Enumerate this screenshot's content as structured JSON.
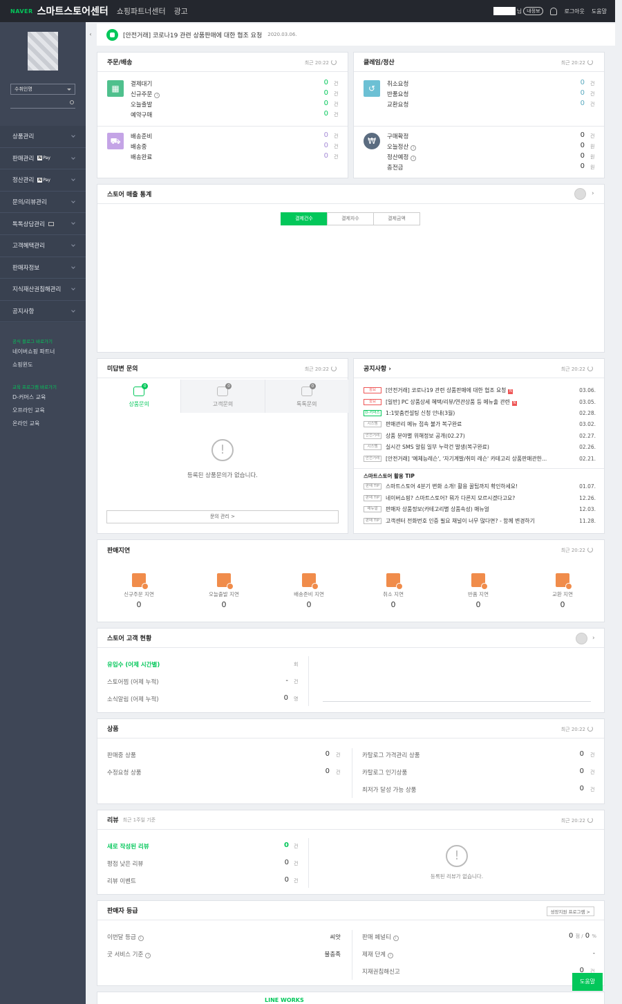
{
  "topbar": {
    "brand": "NAVER",
    "app_title": "스마트스토어센터",
    "nav": [
      "쇼핑파트너센터",
      "광고"
    ],
    "user_suffix": "님",
    "my_info": "내정보",
    "logout": "로그아웃",
    "help": "도움말"
  },
  "sidebar": {
    "select": "수취인명",
    "menu": [
      {
        "label": "상품관리"
      },
      {
        "label": "판매관리",
        "badge": "Pay"
      },
      {
        "label": "정산관리",
        "badge": "Pay"
      },
      {
        "label": "문의/리뷰관리"
      },
      {
        "label": "톡톡상담관리"
      },
      {
        "label": "고객혜택관리"
      },
      {
        "label": "판매자정보"
      },
      {
        "label": "지식재산권침해관리"
      },
      {
        "label": "공지사항"
      }
    ],
    "official_title": "공식 블로그 바로가기",
    "official_links": [
      "네이버쇼핑 파트너",
      "쇼핑윈도"
    ],
    "edu_title": "교육 프로그램 바로가기",
    "edu_links": [
      "D-커머스 교육",
      "오프라인 교육",
      "온라인 교육"
    ]
  },
  "notice_bar": {
    "text": "[안전거래] 코로나19 관련 상품판매에 대한 협조 요청",
    "date": "2020.03.06."
  },
  "refresh_label": "최근 20:22",
  "order": {
    "title": "주문/배송",
    "group1": [
      {
        "label": "결제대기",
        "value": "0",
        "unit": "건"
      },
      {
        "label": "신규주문",
        "value": "0",
        "unit": "건"
      },
      {
        "label": "오늘출발",
        "value": "0",
        "unit": "건"
      },
      {
        "label": "예약구매",
        "value": "0",
        "unit": "건"
      }
    ],
    "group2": [
      {
        "label": "배송준비",
        "value": "0",
        "unit": "건"
      },
      {
        "label": "배송중",
        "value": "0",
        "unit": "건"
      },
      {
        "label": "배송완료",
        "value": "0",
        "unit": "건"
      }
    ]
  },
  "claim": {
    "title": "클레임/정산",
    "group1": [
      {
        "label": "취소요청",
        "value": "0",
        "unit": "건"
      },
      {
        "label": "반품요청",
        "value": "0",
        "unit": "건"
      },
      {
        "label": "교환요청",
        "value": "0",
        "unit": "건"
      }
    ],
    "group2": [
      {
        "label": "구매확정",
        "value": "0",
        "unit": "건"
      },
      {
        "label": "오늘정산",
        "value": "0",
        "unit": "원"
      },
      {
        "label": "정산예정",
        "value": "0",
        "unit": "원"
      },
      {
        "label": "충전금",
        "value": "0",
        "unit": "원"
      }
    ]
  },
  "sales_stats": {
    "title": "스토어 매출 통계",
    "tabs": [
      "결제건수",
      "결제자수",
      "결제금액"
    ]
  },
  "inquiry": {
    "title": "미답변 문의",
    "tabs": [
      {
        "label": "상품문의",
        "count": "0"
      },
      {
        "label": "고객문의",
        "count": "0"
      },
      {
        "label": "톡톡문의",
        "count": "0"
      }
    ],
    "empty": "등록된 상품문의가 없습니다.",
    "manage": "문의 관리 >"
  },
  "notices": {
    "title": "공지사항",
    "items": [
      {
        "tag": "중요",
        "text": "[안전거래] 코로나19 관련 상품판매에 대한 협조 요청",
        "new": "N",
        "date": "03.06."
      },
      {
        "tag": "중요",
        "text": "[일반] PC 상품상세 혜택/리뷰/연관상품 등 메뉴출 관련",
        "new": "N",
        "date": "03.05."
      },
      {
        "tag": "D-커머스",
        "text": "1:1맞춤컨설팅 신청 안내(3월)",
        "date": "02.28."
      },
      {
        "tag": "시스템",
        "text": "판매관리 메뉴 접속 불가 복구완료",
        "date": "03.02."
      },
      {
        "tag": "안전거래",
        "text": "상품 분야별 위해정보 공개(02.27)",
        "date": "02.27."
      },
      {
        "tag": "시스템",
        "text": "실시간 SMS 알림 일부 누락건 발생(복구완료)",
        "date": "02.26."
      },
      {
        "tag": "안전거래",
        "text": "[안전거래] '예체능레슨', '자기계발/취미 레슨' 카테고리 상품판매관한...",
        "date": "02.21."
      }
    ],
    "tip_title": "스마트스토어 활용 TIP",
    "tips": [
      {
        "tag": "판매 TIP",
        "text": "스마트스토어 4분기 변화 소개! 활용 꿀팁까지 확인하세요!",
        "date": "01.07."
      },
      {
        "tag": "판매 TIP",
        "text": "네이버쇼핑? 스마트스토어? 뭐가 다른지 모르시겠다고요?",
        "date": "12.26."
      },
      {
        "tag": "매뉴얼",
        "text": "판매자 상품정보(카테고리별 상품속성) 매뉴얼",
        "date": "12.03."
      },
      {
        "tag": "판매 TIP",
        "text": "고객센터 전화번호 인증 필요 채널이 너무 많다면? - 함께 변경하기",
        "date": "11.28."
      }
    ]
  },
  "delay": {
    "title": "판매지연",
    "items": [
      {
        "label": "신규주문 지연",
        "value": "0"
      },
      {
        "label": "오늘출발 지연",
        "value": "0"
      },
      {
        "label": "배송준비 지연",
        "value": "0"
      },
      {
        "label": "취소 지연",
        "value": "0"
      },
      {
        "label": "반품 지연",
        "value": "0"
      },
      {
        "label": "교환 지연",
        "value": "0"
      }
    ]
  },
  "customer": {
    "title": "스토어 고객 현황",
    "rows": [
      {
        "label": "유입수 (어제 시간별)",
        "value": "",
        "unit": "회"
      },
      {
        "label": "스토어찜 (어제 누적)",
        "value": "-",
        "unit": "건"
      },
      {
        "label": "소식알림 (어제 누적)",
        "value": "0",
        "unit": "명"
      }
    ]
  },
  "product": {
    "title": "상품",
    "left": [
      {
        "label": "판매중 상품",
        "value": "0",
        "unit": "건"
      },
      {
        "label": "수정요청 상품",
        "value": "0",
        "unit": "건"
      }
    ],
    "right": [
      {
        "label": "카탈로그 가격관리 상품",
        "value": "0",
        "unit": "건"
      },
      {
        "label": "카탈로그 인기상품",
        "value": "0",
        "unit": "건"
      },
      {
        "label": "최저가 달성 가능 상품",
        "value": "0",
        "unit": "건"
      }
    ]
  },
  "review": {
    "title": "리뷰",
    "subtitle": "최근 1주일 기준",
    "rows": [
      {
        "label": "새로 작성된 리뷰",
        "value": "0",
        "unit": "건"
      },
      {
        "label": "평점 낮은 리뷰",
        "value": "0",
        "unit": "건"
      },
      {
        "label": "리뷰 이벤트",
        "value": "0",
        "unit": "건"
      }
    ],
    "empty": "등록된 리뷰가 없습니다."
  },
  "grade": {
    "title": "판매자 등급",
    "program": "성장지원 프로그램 >",
    "left": [
      {
        "label": "이번달 등급",
        "value": "씨앗"
      },
      {
        "label": "굿 서비스 기준",
        "value": "불충족"
      }
    ],
    "right": [
      {
        "label": "판매 페널티",
        "value": "0",
        "sep": "점 /",
        "value2": "0",
        "unit": "%"
      },
      {
        "label": "제재 단계",
        "value": "-"
      },
      {
        "label": "지재권침해신고",
        "value": "0",
        "unit": "건"
      }
    ]
  },
  "footer": {
    "help_button": "도움말",
    "lineworks": "LINE WORKS"
  }
}
